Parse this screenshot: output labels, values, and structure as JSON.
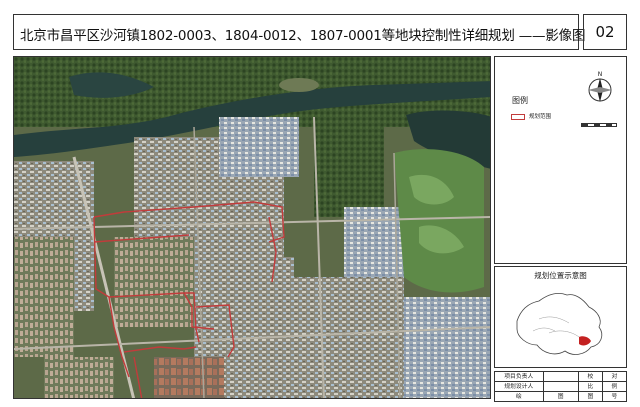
{
  "title": "北京市昌平区沙河镇1802-0003、1804-0012、1807-0001等地块控制性详细规划 ——影像图",
  "sheet_number": "02",
  "legend": {
    "title": "图例",
    "items": [
      {
        "label": "规划范围",
        "color": "#c23b3b"
      }
    ]
  },
  "north_arrow": {
    "label": "N",
    "icon": "north-arrow-icon"
  },
  "location_map": {
    "title": "规划位置示意图",
    "highlight_color": "#c42121"
  },
  "info_table": {
    "rows": [
      [
        "项目负责人",
        "",
        "校",
        "对"
      ],
      [
        "规划设计人",
        "",
        "比",
        "例"
      ],
      [
        "绘",
        "图",
        "图",
        "号"
      ]
    ]
  },
  "colors": {
    "boundary": "#c23b3b",
    "water": "#233c3a",
    "vegetation": "#2f4a2a",
    "golf": "#5e8a48"
  }
}
